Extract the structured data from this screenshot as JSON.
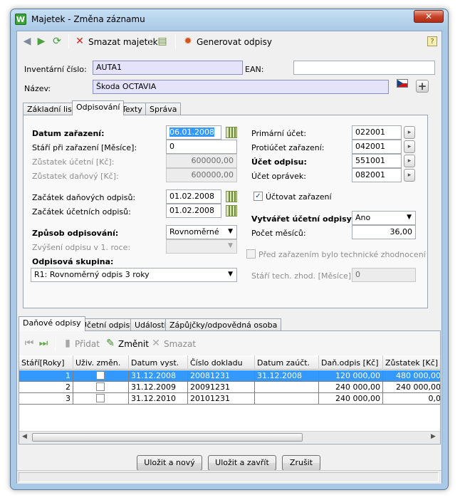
{
  "window": {
    "title": "Majetek - Změna záznamu",
    "app_icon_letter": "W",
    "close": "✕"
  },
  "toolbar": {
    "delete_label": "Smazat majetek",
    "generate_label": "Generovat odpisy"
  },
  "header": {
    "inv_label": "Inventární číslo:",
    "inv_value": "AUTA1",
    "ean_label": "EAN:",
    "ean_value": "",
    "name_label": "Název:",
    "name_value": "Škoda OCTAVIA"
  },
  "top_tabs": [
    "Základní list",
    "Odpisování",
    "Texty",
    "Správa"
  ],
  "form": {
    "datum_zarazeni_label": "Datum zařazení:",
    "datum_zarazeni": "06.01.2008",
    "stari_label": "Stáří při zařazení [Měsíce]:",
    "stari": "0",
    "zustatek_ucetni_label": "Zůstatek účetní [Kč]:",
    "zustatek_ucetni": "600000,00",
    "zustatek_danovy_label": "Zůstatek daňový [Kč]:",
    "zustatek_danovy": "600000,00",
    "zacatek_danovych_label": "Začátek daňových odpisů:",
    "zacatek_danovych": "01.02.2008",
    "zacatek_ucetnich_label": "Začátek účetních odpisů:",
    "zacatek_ucetnich": "01.02.2008",
    "zpusob_label": "Způsob odpisování:",
    "zpusob": "Rovnoměrné",
    "zvyseni_label": "Zvýšení odpisu v 1. roce:",
    "zvyseni": "",
    "skupina_label": "Odpisová skupina:",
    "skupina": "R1: Rovnoměrný odpis 3 roky",
    "primarni_label": "Primární účet:",
    "primarni": "022001",
    "protiucet_label": "Protiúčet zařazení:",
    "protiucet": "042001",
    "ucet_odpisu_label": "Účet odpisu:",
    "ucet_odpisu": "551001",
    "ucet_opravek_label": "Účet oprávek:",
    "ucet_opravek": "082001",
    "uctovat_label": "Účtovat zařazení",
    "vytvaret_label": "Vytvářet účetní odpisy:",
    "vytvaret": "Ano",
    "pocet_label": "Počet měsíců:",
    "pocet": "36,00",
    "pred_label": "Před zařazením bylo technické zhodnocení",
    "stari_tech_label": "Stáří tech. zhod. [Měsíce]:",
    "stari_tech": "0"
  },
  "bottom_tabs": [
    "Daňové odpisy",
    "Účetní odpisy",
    "Události",
    "Zápůjčky/odpovědná osoba"
  ],
  "grid_toolbar": {
    "add": "Přidat",
    "edit": "Změnit",
    "delete": "Smazat"
  },
  "grid": {
    "headers": [
      "Stáří[Roky]",
      "Uživ. změn.",
      "Datum vyst.",
      "Číslo dokladu",
      "Datum zaúčt.",
      "Daň.odpis [Kč]",
      "Zůstatek [Kč]"
    ],
    "rows": [
      {
        "year": "1",
        "date": "31.12.2008",
        "doc": "20081231",
        "posted": "31.12.2008",
        "dep": "120 000,00",
        "rem": "480 000,00"
      },
      {
        "year": "2",
        "date": "31.12.2009",
        "doc": "20091231",
        "posted": "",
        "dep": "240 000,00",
        "rem": "240 000,00"
      },
      {
        "year": "3",
        "date": "31.12.2010",
        "doc": "20101231",
        "posted": "",
        "dep": "240 000,00",
        "rem": "0,0"
      }
    ]
  },
  "buttons": {
    "save_new": "Uložit a nový",
    "save_close": "Uložit a zavřít",
    "cancel": "Zrušit"
  },
  "colors": {
    "selection": "#3399ff",
    "highlight_input": "#e4e3fa"
  }
}
